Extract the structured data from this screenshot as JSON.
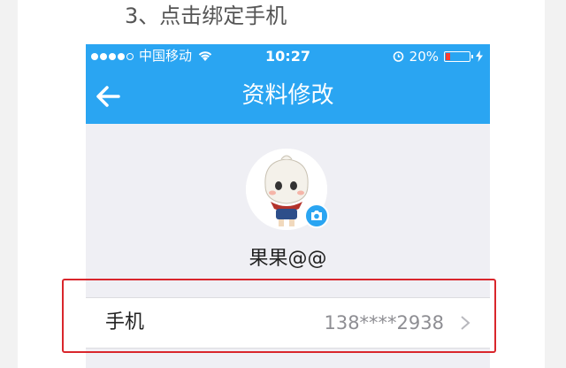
{
  "step": {
    "title": "3、点击绑定手机"
  },
  "status_bar": {
    "carrier": "中国移动",
    "time": "10:27",
    "battery": "20%",
    "battery_level": 0.2
  },
  "nav": {
    "title": "资料修改",
    "back_icon": "arrow-left-icon"
  },
  "profile": {
    "nickname": "果果@@",
    "camera_icon": "camera-icon"
  },
  "phone_row": {
    "label": "手机",
    "value": "138****2938",
    "chevron_icon": "chevron-right-icon"
  },
  "colors": {
    "accent": "#2aa5f2",
    "highlight": "#d9262c",
    "background": "#efeff4"
  }
}
